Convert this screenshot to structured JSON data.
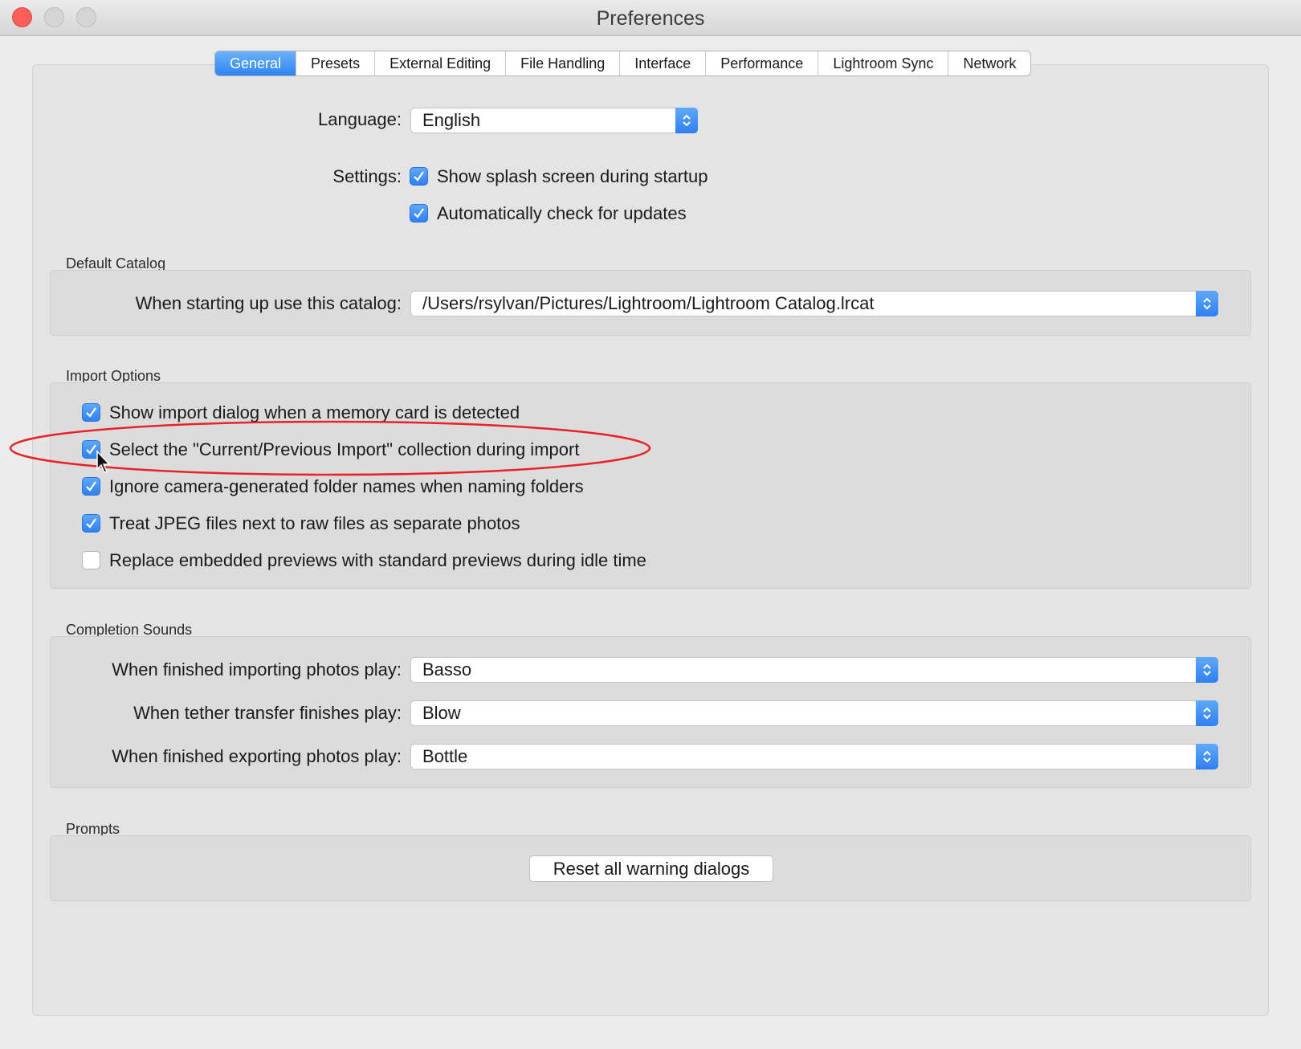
{
  "window": {
    "title": "Preferences"
  },
  "tabs": [
    {
      "label": "General",
      "active": true
    },
    {
      "label": "Presets",
      "active": false
    },
    {
      "label": "External Editing",
      "active": false
    },
    {
      "label": "File Handling",
      "active": false
    },
    {
      "label": "Interface",
      "active": false
    },
    {
      "label": "Performance",
      "active": false
    },
    {
      "label": "Lightroom Sync",
      "active": false
    },
    {
      "label": "Network",
      "active": false
    }
  ],
  "general": {
    "language_label": "Language:",
    "language_value": "English",
    "settings_label": "Settings:",
    "settings": [
      {
        "label": "Show splash screen during startup",
        "checked": true
      },
      {
        "label": "Automatically check for updates",
        "checked": true
      }
    ]
  },
  "default_catalog": {
    "title": "Default Catalog",
    "label": "When starting up use this catalog:",
    "value": "/Users/rsylvan/Pictures/Lightroom/Lightroom Catalog.lrcat"
  },
  "import_options": {
    "title": "Import Options",
    "items": [
      {
        "label": "Show import dialog when a memory card is detected",
        "checked": true
      },
      {
        "label": "Select the \"Current/Previous Import\" collection during import",
        "checked": true
      },
      {
        "label": "Ignore camera-generated folder names when naming folders",
        "checked": true
      },
      {
        "label": "Treat JPEG files next to raw files as separate photos",
        "checked": true
      },
      {
        "label": "Replace embedded previews with standard previews during idle time",
        "checked": false
      }
    ]
  },
  "completion_sounds": {
    "title": "Completion Sounds",
    "rows": [
      {
        "label": "When finished importing photos play:",
        "value": "Basso"
      },
      {
        "label": "When tether transfer finishes play:",
        "value": "Blow"
      },
      {
        "label": "When finished exporting photos play:",
        "value": "Bottle"
      }
    ]
  },
  "prompts": {
    "title": "Prompts",
    "reset_button": "Reset all warning dialogs"
  },
  "colors": {
    "accent": "#2f80f3",
    "annotation": "#e8232a"
  }
}
